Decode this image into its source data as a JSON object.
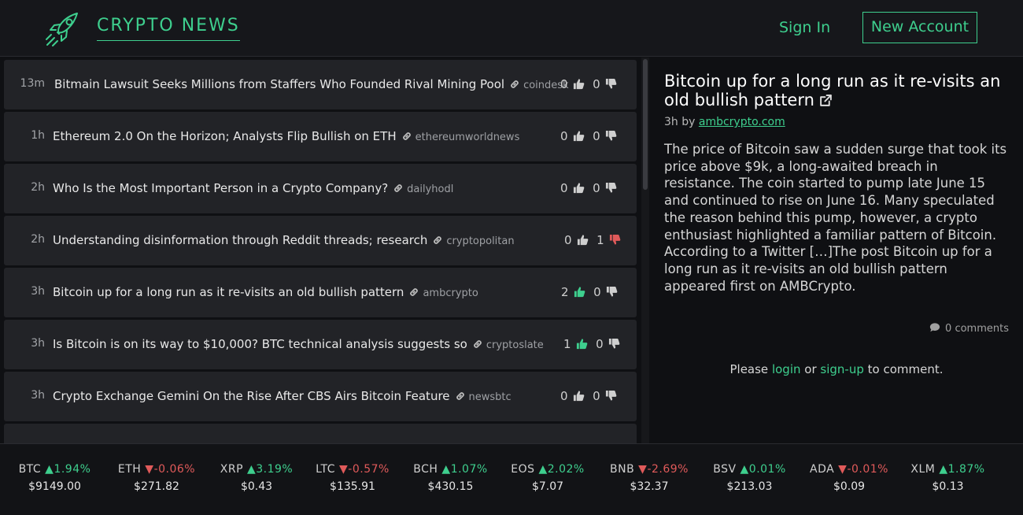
{
  "header": {
    "brand": "CRYPTO NEWS",
    "sign_in": "Sign In",
    "new_account": "New Account"
  },
  "news": [
    {
      "time": "13m",
      "title": "Bitmain Lawsuit Seeks Millions from Staffers Who Founded Rival Mining Pool",
      "source": "coindesk",
      "up": "0",
      "down": "0",
      "voted": "none"
    },
    {
      "time": "1h",
      "title": "Ethereum 2.0 On the Horizon; Analysts Flip Bullish on ETH",
      "source": "ethereumworldnews",
      "up": "0",
      "down": "0",
      "voted": "none"
    },
    {
      "time": "2h",
      "title": "Who Is the Most Important Person in a Crypto Company?",
      "source": "dailyhodl",
      "up": "0",
      "down": "0",
      "voted": "none"
    },
    {
      "time": "2h",
      "title": "Understanding disinformation through Reddit threads; research",
      "source": "cryptopolitan",
      "up": "0",
      "down": "1",
      "voted": "down"
    },
    {
      "time": "3h",
      "title": "Bitcoin up for a long run as it re-visits an old bullish pattern",
      "source": "ambcrypto",
      "up": "2",
      "down": "0",
      "voted": "up"
    },
    {
      "time": "3h",
      "title": "Is Bitcoin is on its way to $10,000? BTC technical analysis suggests so",
      "source": "cryptoslate",
      "up": "1",
      "down": "0",
      "voted": "up"
    },
    {
      "time": "3h",
      "title": "Crypto Exchange Gemini On the Rise After CBS Airs Bitcoin Feature",
      "source": "newsbtc",
      "up": "0",
      "down": "0",
      "voted": "none"
    }
  ],
  "article": {
    "title": "Bitcoin up for a long run as it re-visits an old bullish pattern",
    "age": "3h",
    "by": "by",
    "author": "ambcrypto.com",
    "body": "The price of Bitcoin saw a sudden surge that took its price above $9k, a long-awaited breach in resistance. The coin started to pump late June 15 and continued to rise on June 16. Many speculated the reason behind this pump, however, a crypto enthusiast highlighted a familiar pattern of Bitcoin. According to a Twitter […]The post Bitcoin up for a long run as it re-visits an old bullish pattern appeared first on AMBCrypto.",
    "comments": "0 comments",
    "please": "Please",
    "login": "login",
    "or": "or",
    "signup": "sign-up",
    "to_comment": "to comment."
  },
  "ticker": [
    {
      "symbol": "BTC",
      "change": "1.94%",
      "dir": "up",
      "price": "$9149.00"
    },
    {
      "symbol": "ETH",
      "change": "-0.06%",
      "dir": "down",
      "price": "$271.82"
    },
    {
      "symbol": "XRP",
      "change": "3.19%",
      "dir": "up",
      "price": "$0.43"
    },
    {
      "symbol": "LTC",
      "change": "-0.57%",
      "dir": "down",
      "price": "$135.91"
    },
    {
      "symbol": "BCH",
      "change": "1.07%",
      "dir": "up",
      "price": "$430.15"
    },
    {
      "symbol": "EOS",
      "change": "2.02%",
      "dir": "up",
      "price": "$7.07"
    },
    {
      "symbol": "BNB",
      "change": "-2.69%",
      "dir": "down",
      "price": "$32.37"
    },
    {
      "symbol": "BSV",
      "change": "0.01%",
      "dir": "up",
      "price": "$213.03"
    },
    {
      "symbol": "ADA",
      "change": "-0.01%",
      "dir": "down",
      "price": "$0.09"
    },
    {
      "symbol": "XLM",
      "change": "1.87%",
      "dir": "up",
      "price": "$0.13"
    }
  ],
  "colors": {
    "accent": "#3ecf8e",
    "negative": "#e05a5a",
    "row_bg": "#222327"
  }
}
